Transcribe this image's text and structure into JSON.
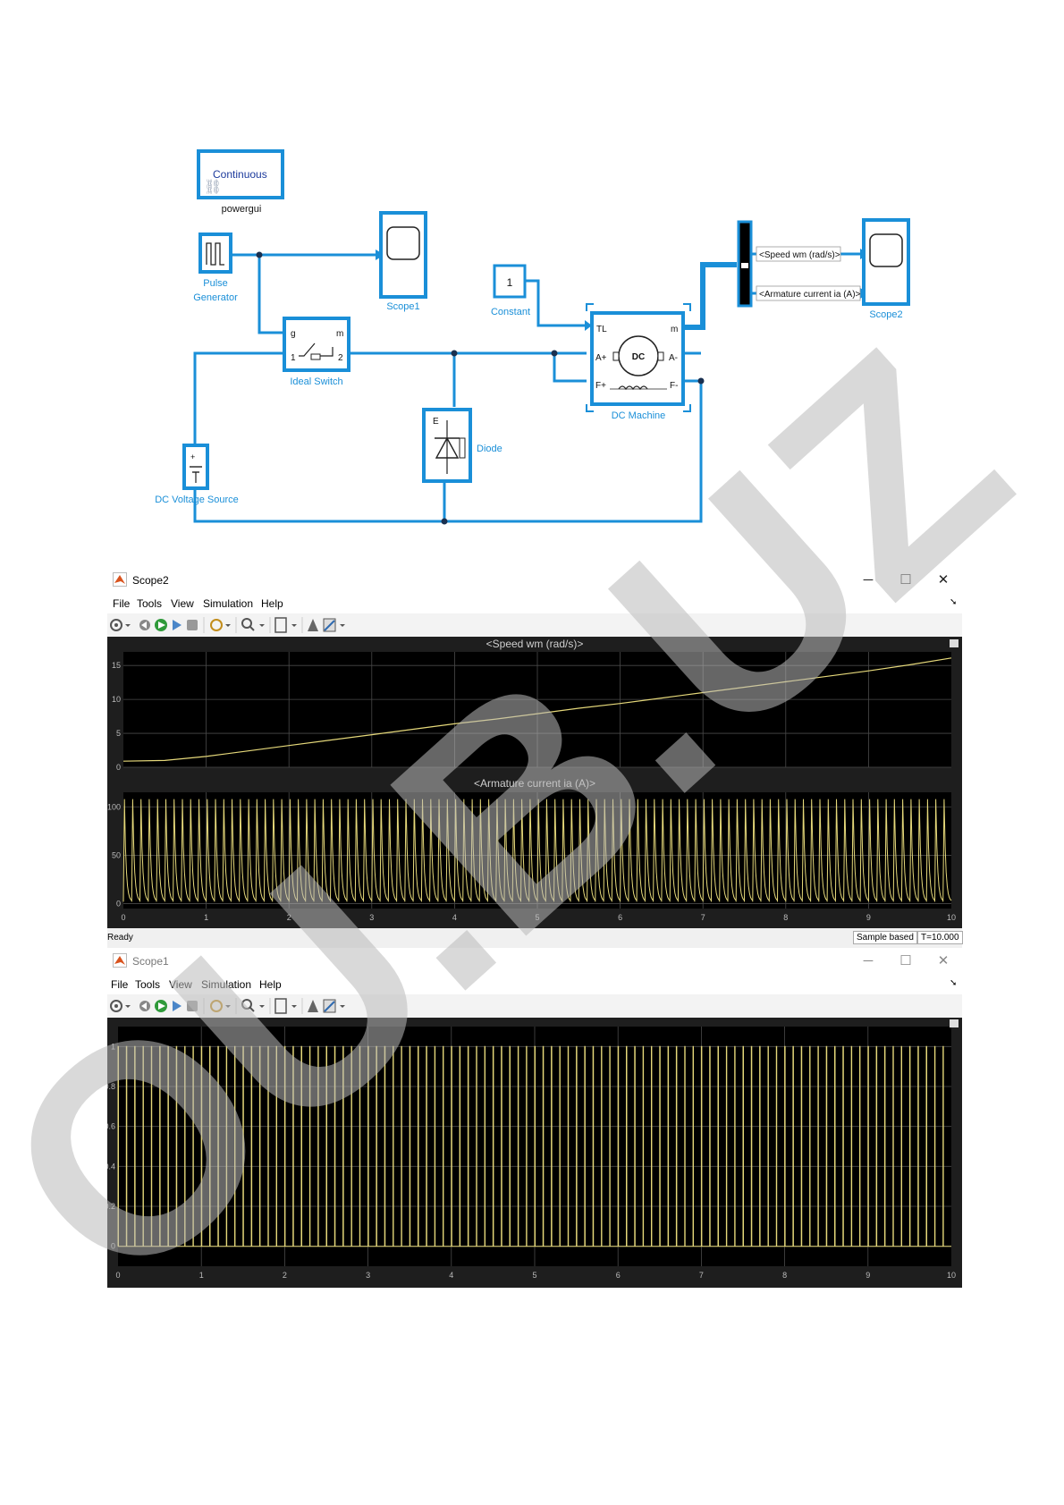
{
  "model": {
    "powergui_block": "Continuous",
    "powergui_label": "powergui",
    "pulse_label_line1": "Pulse",
    "pulse_label_line2": "Generator",
    "scope1_label": "Scope1",
    "constant_value": "1",
    "constant_label": "Constant",
    "ideal_switch_label": "Ideal Switch",
    "switch_port_g": "g",
    "switch_port_m": "m",
    "switch_port_1": "1",
    "switch_port_2": "2",
    "diode_label": "Diode",
    "diode_port_e": "E",
    "dc_source_label": "DC Voltage Source",
    "dc_machine_label": "DC Machine",
    "dc_machine_text": "DC",
    "port_tl": "TL",
    "port_m": "m",
    "port_aplus": "A+",
    "port_aminus": "A-",
    "port_fplus": "F+",
    "port_fminus": "F-",
    "signal_speed": "<Speed wm (rad/s)>",
    "signal_current": "<Armature current ia (A)>",
    "scope2_label": "Scope2"
  },
  "scope2": {
    "title": "Scope2",
    "menu": [
      "File",
      "Tools",
      "View",
      "Simulation",
      "Help"
    ],
    "status_ready": "Ready",
    "status_sample": "Sample based",
    "status_time": "T=10.000"
  },
  "scope1": {
    "title": "Scope1",
    "menu": [
      "File",
      "Tools",
      "View",
      "Simulation",
      "Help"
    ]
  },
  "colors": {
    "block_blue": "#1a8fd8",
    "trace": "#e5d87a",
    "plot_bg": "#000000",
    "frame_bg": "#1e1e1e",
    "grid": "#4a4a4a"
  },
  "chart_data": [
    {
      "type": "line",
      "title": "<Speed wm (rad/s)>",
      "xlim": [
        0,
        10
      ],
      "ylim": [
        0,
        17
      ],
      "xticks": [
        0,
        1,
        2,
        3,
        4,
        5,
        6,
        7,
        8,
        9,
        10
      ],
      "yticks": [
        0,
        5,
        10,
        15
      ],
      "grid": true,
      "series": [
        {
          "x": [
            0,
            0.5,
            1,
            1.5,
            2,
            2.5,
            3,
            3.5,
            4,
            4.5,
            5,
            5.5,
            6,
            6.5,
            7,
            7.5,
            8,
            8.5,
            9,
            9.5,
            10
          ],
          "values": [
            0.9,
            1.0,
            1.6,
            2.4,
            3.2,
            4.0,
            4.8,
            5.6,
            6.4,
            7.1,
            7.9,
            8.7,
            9.4,
            10.2,
            11.0,
            11.8,
            12.6,
            13.4,
            14.2,
            15.1,
            16.1
          ]
        }
      ]
    },
    {
      "type": "line",
      "title": "<Armature current ia (A)>",
      "xlim": [
        0,
        10
      ],
      "ylim": [
        -5,
        115
      ],
      "xticks": [
        0,
        1,
        2,
        3,
        4,
        5,
        6,
        7,
        8,
        9,
        10
      ],
      "yticks": [
        0,
        50,
        100
      ],
      "grid": true,
      "series": [
        {
          "pulses": 100,
          "period": 0.1,
          "peak": 108,
          "baseline": 2,
          "x_range": [
            0,
            10
          ]
        }
      ]
    },
    {
      "type": "line",
      "title": "",
      "xlim": [
        0,
        10
      ],
      "ylim": [
        -0.1,
        1.1
      ],
      "xticks": [
        0,
        1,
        2,
        3,
        4,
        5,
        6,
        7,
        8,
        9,
        10
      ],
      "yticks": [
        0,
        0.2,
        0.4,
        0.6,
        0.8,
        1
      ],
      "grid": true,
      "series": [
        {
          "pulses": 100,
          "period": 0.1,
          "high": 1,
          "low": 0,
          "x_range": [
            0,
            10
          ]
        }
      ]
    }
  ]
}
